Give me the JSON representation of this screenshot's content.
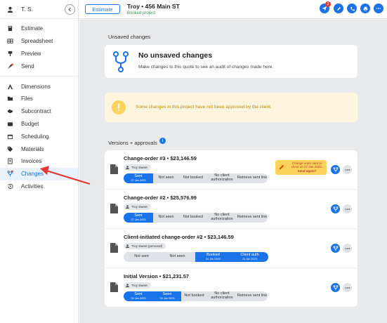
{
  "user": {
    "initials": "T. S."
  },
  "sidebar": {
    "group1": [
      {
        "label": "Estimate",
        "icon": "calculator-icon"
      },
      {
        "label": "Spreadsheet",
        "icon": "table-icon"
      },
      {
        "label": "Preview",
        "icon": "preview-icon"
      },
      {
        "label": "Send",
        "icon": "send-icon"
      }
    ],
    "group2": [
      {
        "label": "Dimensions",
        "icon": "ruler-icon"
      },
      {
        "label": "Files",
        "icon": "folder-icon"
      },
      {
        "label": "Subcontract",
        "icon": "handshake-icon"
      },
      {
        "label": "Budget",
        "icon": "wallet-icon"
      },
      {
        "label": "Scheduling",
        "icon": "calendar-icon"
      },
      {
        "label": "Materials",
        "icon": "tag-icon"
      },
      {
        "label": "Invoices",
        "icon": "invoice-icon"
      },
      {
        "label": "Changes",
        "icon": "fork-icon",
        "active": true
      },
      {
        "label": "Activities",
        "icon": "history-icon"
      }
    ]
  },
  "header": {
    "estimate_button": "Estimate",
    "project_title": "Troy • 456 Main ST",
    "project_status": "Booked project",
    "notification_count": "2"
  },
  "main": {
    "unsaved_label": "Unsaved changes",
    "no_changes_title": "No unsaved changes",
    "no_changes_sub": "Make changes to this quote to see an audit of changes made here.",
    "warning_text": "Some changes in this project have not been approved by the client.",
    "versions_label": "Versions + approvals",
    "versions": [
      {
        "title": "Change-order #3 • $23,146.59",
        "tag": "Troy Sweet",
        "steps": [
          {
            "label": "Sent",
            "date": "27 Jan 2023",
            "on": true,
            "w": 42
          },
          {
            "label": "Not seen",
            "date": "",
            "on": false,
            "w": 37
          },
          {
            "label": "Not booked",
            "date": "",
            "on": false,
            "w": 40
          },
          {
            "label": "No client authorization",
            "date": "",
            "on": false,
            "w": 42
          },
          {
            "label": "Retrieve sent link",
            "date": "",
            "on": false,
            "w": 44
          }
        ],
        "note": {
          "text": "Change order sent to client on 27 Jan 2023.",
          "strong": "Send again?"
        }
      },
      {
        "title": "Change-order #2 • $25,576.99",
        "tag": "Troy Sweet",
        "steps": [
          {
            "label": "Sent",
            "date": "27 Jan 2023",
            "on": true,
            "w": 42
          },
          {
            "label": "Not seen",
            "date": "",
            "on": false,
            "w": 37
          },
          {
            "label": "Not booked",
            "date": "",
            "on": false,
            "w": 40
          },
          {
            "label": "No client authorization",
            "date": "",
            "on": false,
            "w": 42
          },
          {
            "label": "Retrieve sent link",
            "date": "",
            "on": false,
            "w": 44
          }
        ]
      },
      {
        "title": "Client-initiated change-order #2 • $23,146.59",
        "tag": "Troy Sweet (personal)",
        "steps": [
          {
            "label": "Not sent",
            "date": "",
            "on": false,
            "w": 51
          },
          {
            "label": "Not seen",
            "date": "",
            "on": false,
            "w": 51
          },
          {
            "label": "Booked",
            "date": "24 Jan 2023",
            "on": true,
            "w": 51
          },
          {
            "label": "Client auth",
            "date": "24 Jan 2023",
            "on": true,
            "w": 53
          }
        ]
      },
      {
        "title": "Initial Version • $21,231.57",
        "tag": "Troy Sweet",
        "steps": [
          {
            "label": "Sent",
            "date": "24 Jan 2023",
            "on": true,
            "w": 42
          },
          {
            "label": "Seen",
            "date": "24 Jan 2023",
            "on": true,
            "w": 40
          },
          {
            "label": "Not booked",
            "date": "",
            "on": false,
            "w": 37
          },
          {
            "label": "No client authorization",
            "date": "",
            "on": false,
            "w": 42
          },
          {
            "label": "Retrieve sent link",
            "date": "",
            "on": false,
            "w": 44
          }
        ]
      }
    ]
  },
  "colors": {
    "accent": "#1a73e8",
    "warning": "#c08a00",
    "arrow": "#e53935"
  }
}
